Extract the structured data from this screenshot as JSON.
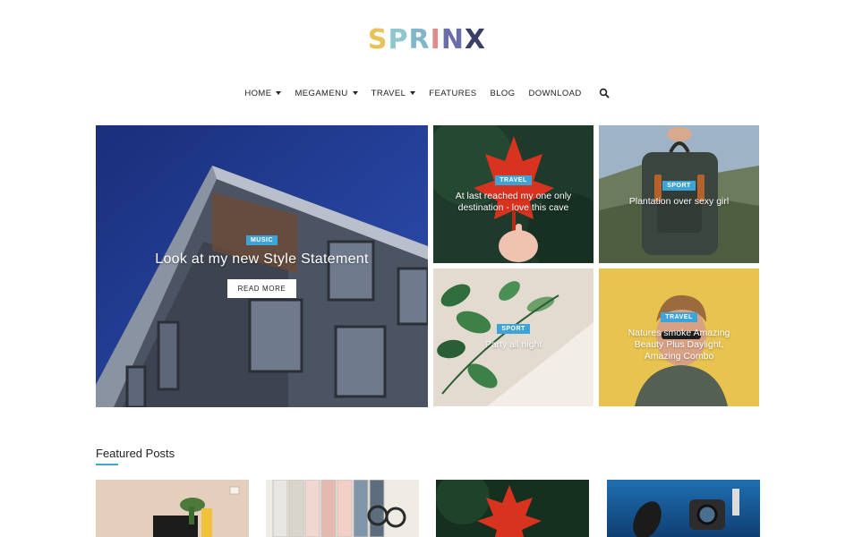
{
  "logo": {
    "text": "SPRINX",
    "letters": [
      "S",
      "P",
      "R",
      "I",
      "N",
      "X"
    ],
    "colors": [
      "#e8c35a",
      "#8fc7cf",
      "#7fb6c9",
      "#e08a8a",
      "#6a6ea8",
      "#3a3f6a"
    ]
  },
  "nav": {
    "items": [
      {
        "label": "HOME",
        "has_dropdown": true
      },
      {
        "label": "MEGAMENU",
        "has_dropdown": true
      },
      {
        "label": "TRAVEL",
        "has_dropdown": true
      },
      {
        "label": "FEATURES",
        "has_dropdown": false
      },
      {
        "label": "BLOG",
        "has_dropdown": false
      },
      {
        "label": "DOWNLOAD",
        "has_dropdown": false
      }
    ],
    "search_icon": "search-icon"
  },
  "hero": {
    "main": {
      "category": "MUSIC",
      "title": "Look at my new Style Statement",
      "button": "READ MORE"
    },
    "tiles": [
      {
        "category": "TRAVEL",
        "title": "At last reached my one only destination - love this cave"
      },
      {
        "category": "SPORT",
        "title": "Plantation over sexy girl"
      },
      {
        "category": "SPORT",
        "title": "Party all night"
      },
      {
        "category": "TRAVEL",
        "title": "Natures smoke Amazing Beauty Plus Daylight, Amazing Combo"
      }
    ]
  },
  "featured": {
    "heading": "Featured Posts"
  },
  "colors": {
    "accent": "#3ea4d8",
    "text": "#222222"
  }
}
